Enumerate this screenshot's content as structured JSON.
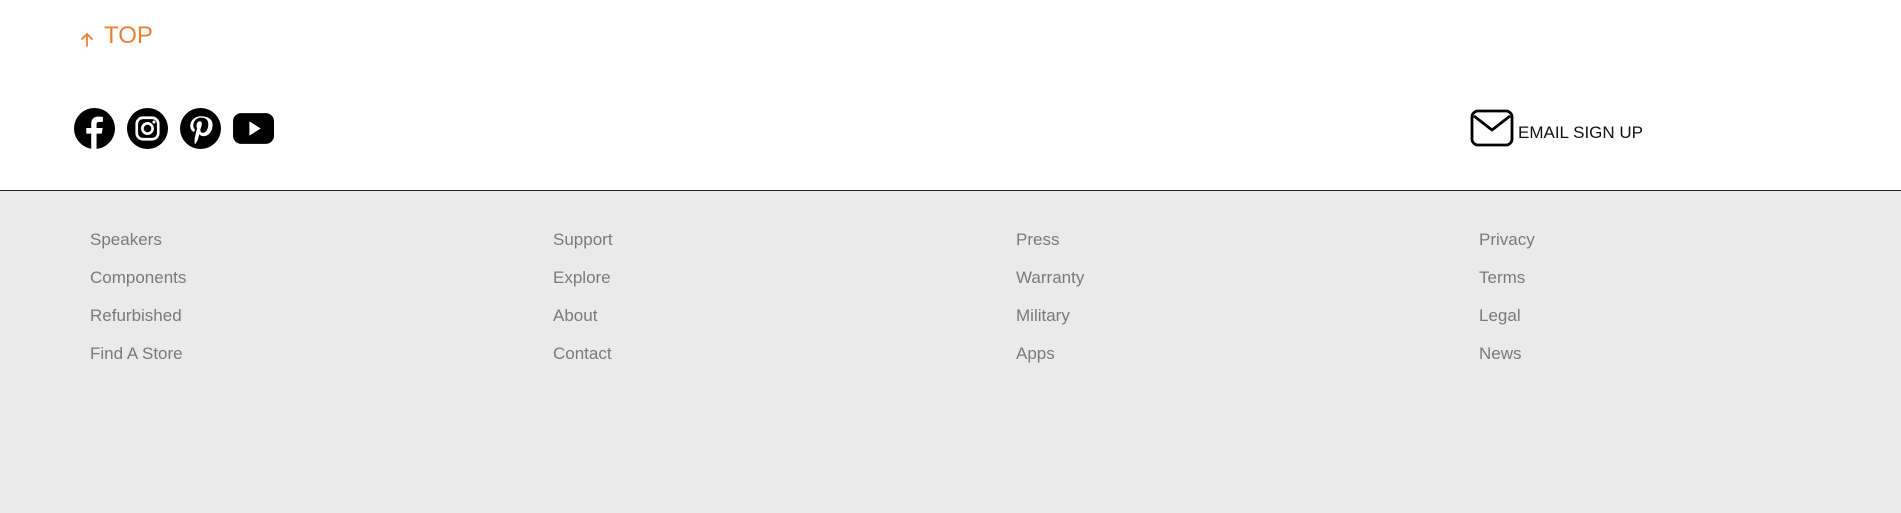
{
  "top_link": {
    "label": "TOP",
    "icon": "arrow-up-icon",
    "color": "#f08030"
  },
  "socials": [
    {
      "name": "facebook",
      "icon": "facebook-icon"
    },
    {
      "name": "instagram",
      "icon": "instagram-icon"
    },
    {
      "name": "pinterest",
      "icon": "pinterest-icon"
    },
    {
      "name": "youtube",
      "icon": "youtube-icon"
    }
  ],
  "email_signup": {
    "label": "EMAIL SIGN UP",
    "icon": "envelope-icon"
  },
  "footer": {
    "background": "#eaeaea",
    "columns": [
      {
        "links": [
          "Speakers",
          "Components",
          "Refurbished",
          "Find A Store"
        ]
      },
      {
        "links": [
          "Support",
          "Explore",
          "About",
          "Contact"
        ]
      },
      {
        "links": [
          "Press",
          "Warranty",
          "Military",
          "Apps"
        ]
      },
      {
        "links": [
          "Privacy",
          "Terms",
          "Legal",
          "News"
        ]
      }
    ]
  }
}
